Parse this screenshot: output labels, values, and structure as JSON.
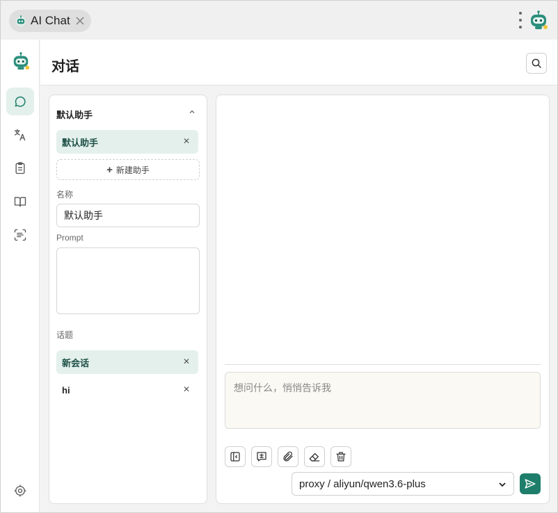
{
  "window": {
    "tab_label": "AI Chat",
    "accent_color": "#1e7e6b",
    "active_bg": "#e3f0ec"
  },
  "nav": {
    "items": [
      {
        "icon": "chat-bubble-icon",
        "active": true
      },
      {
        "icon": "translate-icon",
        "active": false
      },
      {
        "icon": "clipboard-icon",
        "active": false
      },
      {
        "icon": "book-open-icon",
        "active": false
      },
      {
        "icon": "scan-text-icon",
        "active": false
      },
      {
        "icon": "settings-icon",
        "active": false
      }
    ]
  },
  "header": {
    "title": "对话"
  },
  "assistants": {
    "section_title": "默认助手",
    "list": [
      {
        "label": "默认助手",
        "active": true
      }
    ],
    "new_label": "新建助手",
    "name_label": "名称",
    "name_value": "默认助手",
    "prompt_label": "Prompt",
    "prompt_value": ""
  },
  "topics": {
    "section_title": "话题",
    "list": [
      {
        "label": "新会话",
        "active": true
      },
      {
        "label": "hi",
        "active": false
      }
    ]
  },
  "composer": {
    "placeholder": "想问什么，悄悄告诉我",
    "model": "proxy / aliyun/qwen3.6-plus",
    "tools": [
      "toggle-sidebar-icon",
      "quote-icon",
      "attach-icon",
      "eraser-icon",
      "trash-icon"
    ]
  }
}
